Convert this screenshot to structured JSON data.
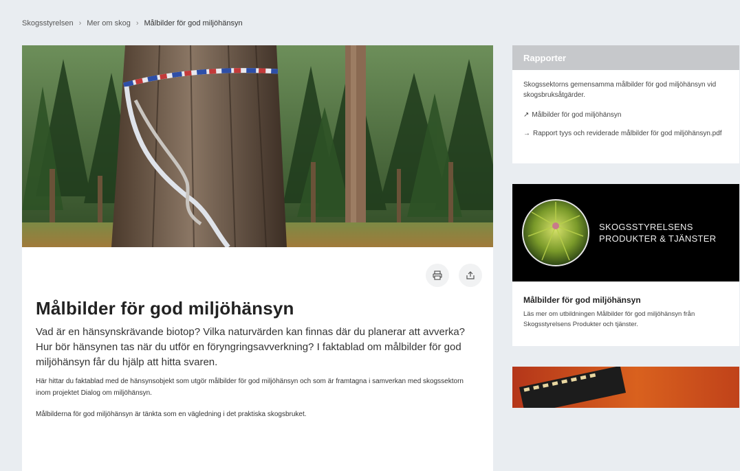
{
  "breadcrumb": {
    "items": [
      "Skogsstyrelsen",
      "Mer om skog",
      "Målbilder för god miljöhänsyn"
    ],
    "separator": "›"
  },
  "article": {
    "title": "Målbilder för god miljöhänsyn",
    "lead": "Vad är en hänsynskrävande biotop? Vilka naturvärden kan finnas där du planerar att avverka? Hur bör hänsynen tas när du utför en föryngringsavverkning? I faktablad om målbilder för god miljöhänsyn får du hjälp att hitta svaren.",
    "body1": "Här hittar du faktablad med de hänsynsobjekt som utgör målbilder för god miljöhänsyn och som är framtagna i samverkan med skogssektorn inom projektet Dialog om miljöhänsyn.",
    "body2": "Målbilderna för god miljöhänsyn är tänkta som en vägledning i det praktiska skogsbruket."
  },
  "tools": {
    "print_icon": "printer-icon",
    "share_icon": "share-icon"
  },
  "reports": {
    "header": "Rapporter",
    "description": "Skogssektorns gemensamma målbilder för god miljöhänsyn vid skogsbruksåtgärder.",
    "link1": "Målbilder för god miljöhänsyn",
    "link2": "Rapport tyys och reviderade målbilder för god miljöhänsyn.pdf"
  },
  "promo": {
    "brand_line1": "SKOGSSTYRELSENS",
    "brand_line2": "PRODUKTER & TJÄNSTER",
    "title": "Målbilder för god miljöhänsyn",
    "text": "Läs mer om utbildningen Målbilder för god miljöhänsyn från Skogsstyrelsens Produkter och tjänster."
  },
  "colors": {
    "background": "#e9edf1",
    "card_header": "#c6c8cb",
    "accent_dark": "#000000"
  }
}
